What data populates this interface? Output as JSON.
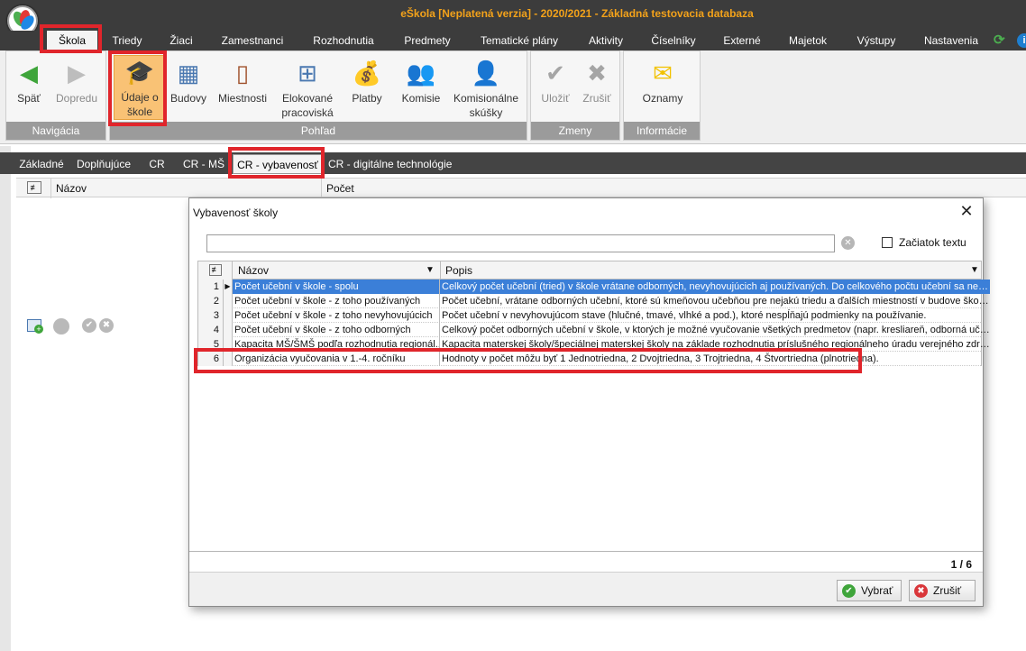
{
  "app": {
    "title": "eŠkola [Neplatená verzia] - 2020/2021 - Základná testovacia databaza"
  },
  "menu": [
    "Škola",
    "Triedy",
    "Žiaci",
    "Zamestnanci",
    "Rozhodnutia",
    "Predmety",
    "Tematické plány",
    "Aktivity",
    "Číselníky",
    "Externé",
    "Majetok",
    "Výstupy",
    "Nastavenia"
  ],
  "ribbon": {
    "groups": {
      "navigacia": "Navigácia",
      "pohlad": "Pohľad",
      "zmeny": "Zmeny",
      "informacie": "Informácie"
    },
    "buttons": {
      "spat": "Späť",
      "dopredu": "Dopredu",
      "udaje1": "Údaje o",
      "udaje2": "škole",
      "budovy": "Budovy",
      "miestnosti": "Miestnosti",
      "elok1": "Elokované",
      "elok2": "pracoviská",
      "platby": "Platby",
      "komisie": "Komisie",
      "kom1": "Komisionálne",
      "kom2": "skúšky",
      "ulozit": "Uložiť",
      "zrusit": "Zrušiť",
      "oznamy": "Oznamy"
    }
  },
  "tabs": [
    "Základné",
    "Doplňujúce",
    "CR",
    "CR - MŠ",
    "CR - vybavenosť",
    "CR - digitálne technológie"
  ],
  "grid": {
    "col_nazov": "Názov",
    "col_pocet": "Počet"
  },
  "dialog": {
    "title": "Vybavenosť školy",
    "search_value": "",
    "checkbox_label": "Začiatok textu",
    "columns": {
      "nazov": "Názov",
      "popis": "Popis"
    },
    "rows": [
      {
        "num": "1",
        "name": "Počet učební v škole - spolu",
        "desc": "Celkový počet učební (tried) v škole vrátane odborných, nevyhovujúcich aj používaných. Do celkového počtu učební sa neza...",
        "selected": true
      },
      {
        "num": "2",
        "name": "Počet učební v škole - z toho používaných",
        "desc": "Počet učební, vrátane odborných učební, ktoré sú kmeňovou učebňou pre nejakú triedu a ďalších miestností v budove školy ..."
      },
      {
        "num": "3",
        "name": "Počet učební v škole - z toho nevyhovujúcich",
        "desc": "Počet učební v nevyhovujúcom stave (hlučné, tmavé, vlhké a pod.), ktoré nespĺňajú podmienky na používanie."
      },
      {
        "num": "4",
        "name": "Počet učební v škole - z toho odborných",
        "desc": "Celkový počet odborných učební v škole, v ktorých je možné vyučovanie všetkých predmetov (napr. kresliareň, odborná učeb..."
      },
      {
        "num": "5",
        "name": "Kapacita MŠ/ŠMŠ podľa rozhodnutia regionál...",
        "desc": "Kapacita materskej školy/špeciálnej materskej školy na základe rozhodnutia príslušného regionálneho úradu verejného zdravot..."
      },
      {
        "num": "6",
        "name": "Organizácia vyučovania v 1.-4. ročníku",
        "desc": "Hodnoty v počet môžu byť 1 Jednotriedna, 2 Dvojtriedna, 3 Trojtriedna, 4 Štvortriedna (plnotriedna)."
      }
    ],
    "pager": "1 / 6",
    "btn_vybrat": "Vybrať",
    "btn_zrusit": "Zrušiť"
  },
  "colors": {
    "title": "#f3a21a",
    "selection": "#3b7fd8",
    "highlight": "#e0252b",
    "accent": "#f9c275"
  }
}
